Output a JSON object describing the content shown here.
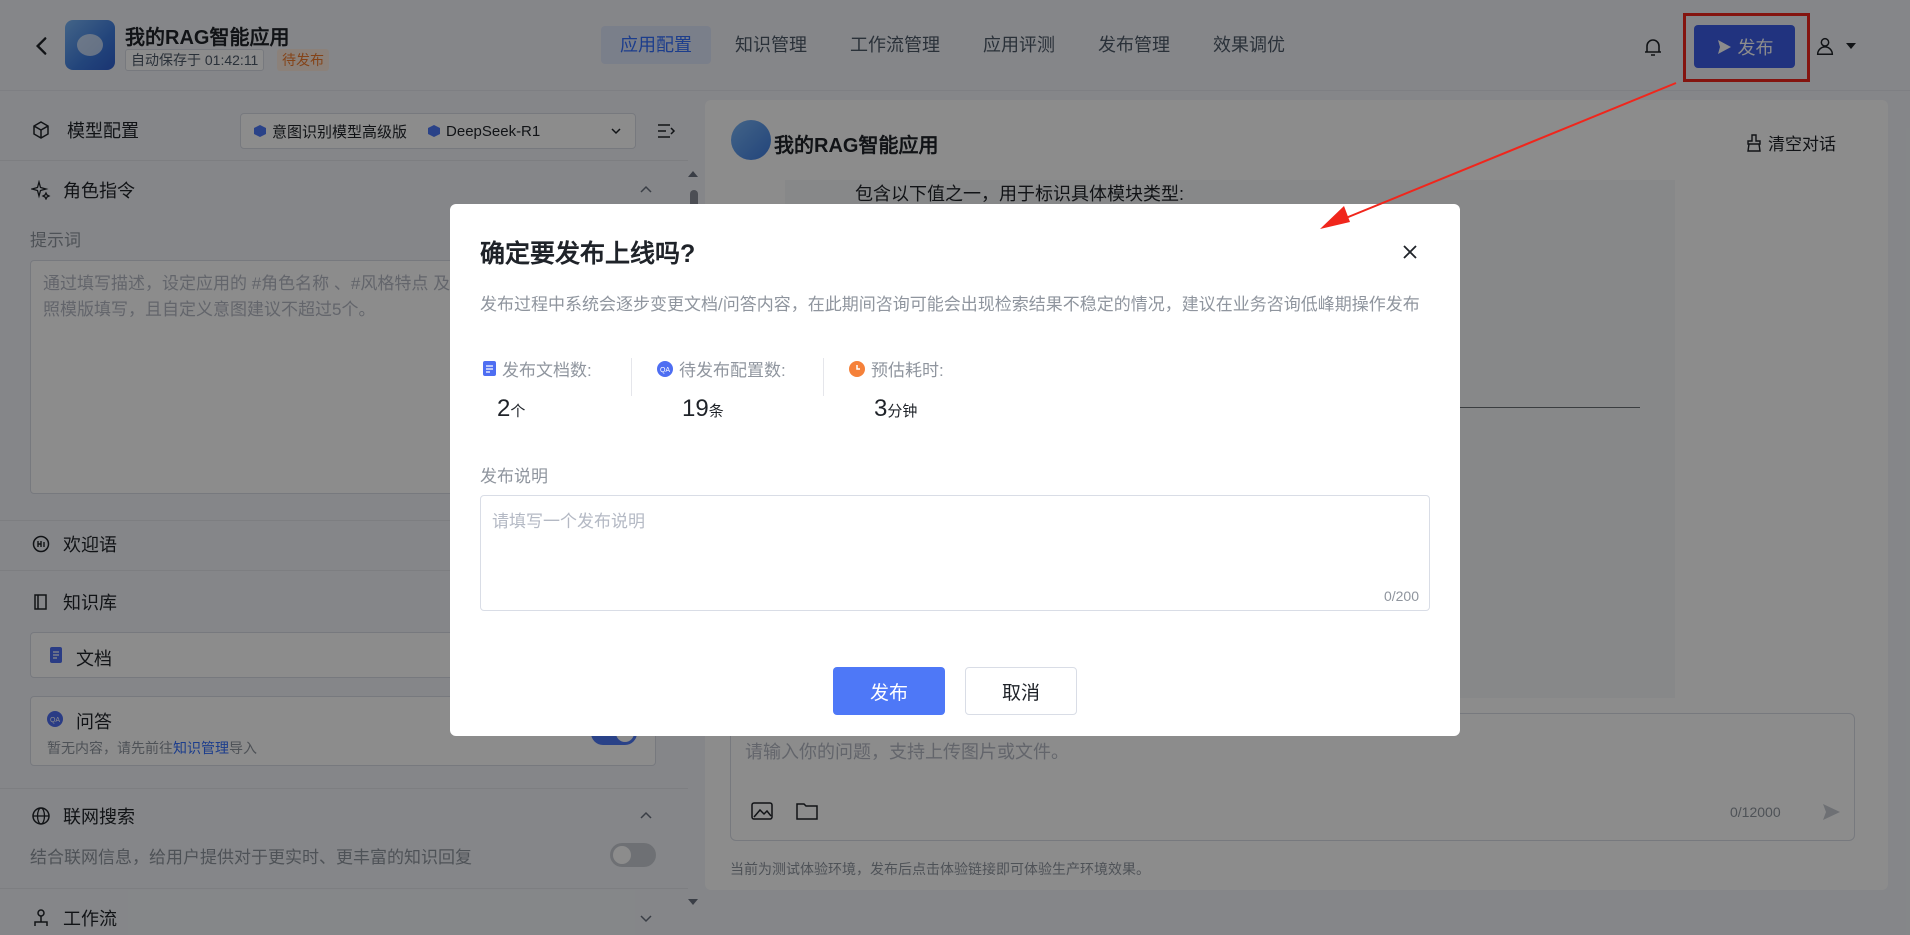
{
  "header": {
    "app_title": "我的RAG智能应用",
    "autosave": "自动保存于 01:42:11",
    "status": "待发布",
    "tabs": [
      {
        "label": "应用配置",
        "active": true
      },
      {
        "label": "知识管理"
      },
      {
        "label": "工作流管理"
      },
      {
        "label": "应用评测"
      },
      {
        "label": "发布管理"
      },
      {
        "label": "效果调优"
      }
    ],
    "publish_label": "发布"
  },
  "left_panel": {
    "model_config_label": "模型配置",
    "model_select": {
      "intent_model": "意图识别模型高级版",
      "llm": "DeepSeek-R1"
    },
    "role_section": "角色指令",
    "prompt_label": "提示词",
    "prompt_placeholder": "通过填写描述，设定应用的 #角色名称 、#风格特点 及\n照模版填写，且自定义意图建议不超过5个。",
    "welcome_section": "欢迎语",
    "kb_section": "知识库",
    "kb_doc": "文档",
    "kb_qa": "问答",
    "kb_qa_hint_prefix": "暂无内容，请先前往",
    "kb_qa_hint_link": "知识管理",
    "kb_qa_hint_suffix": "导入",
    "web_search_section": "联网搜索",
    "web_search_desc": "结合联网信息，给用户提供对于更实时、更丰富的知识回复",
    "workflow_section": "工作流"
  },
  "chat": {
    "title": "我的RAG智能应用",
    "clear_label": "清空对话",
    "message_text": "包含以下值之一，用于标识具体模块类型:",
    "input_placeholder": "请输入你的问题，支持上传图片或文件。",
    "input_counter": "0/12000",
    "footer_note": "当前为测试体验环境，发布后点击体验链接即可体验生产环境效果。"
  },
  "modal": {
    "title": "确定要发布上线吗?",
    "description": "发布过程中系统会逐步变更文档/问答内容，在此期间咨询可能会出现检索结果不稳定的情况，建议在业务咨询低峰期操作发布",
    "stats": [
      {
        "label": "发布文档数:",
        "value": "2",
        "unit": "个",
        "icon": "document-icon",
        "color": "#4e6ef2"
      },
      {
        "label": "待发布配置数:",
        "value": "19",
        "unit": "条",
        "icon": "qa-icon",
        "color": "#4e6ef2"
      },
      {
        "label": "预估耗时:",
        "value": "3",
        "unit": "分钟",
        "icon": "clock-icon",
        "color": "#f5813a"
      }
    ],
    "note_label": "发布说明",
    "note_placeholder": "请填写一个发布说明",
    "note_counter": "0/200",
    "confirm_label": "发布",
    "cancel_label": "取消"
  },
  "colors": {
    "primary": "#3d5ee8",
    "annotation": "#f0261c",
    "pending": "#f07b2c"
  }
}
